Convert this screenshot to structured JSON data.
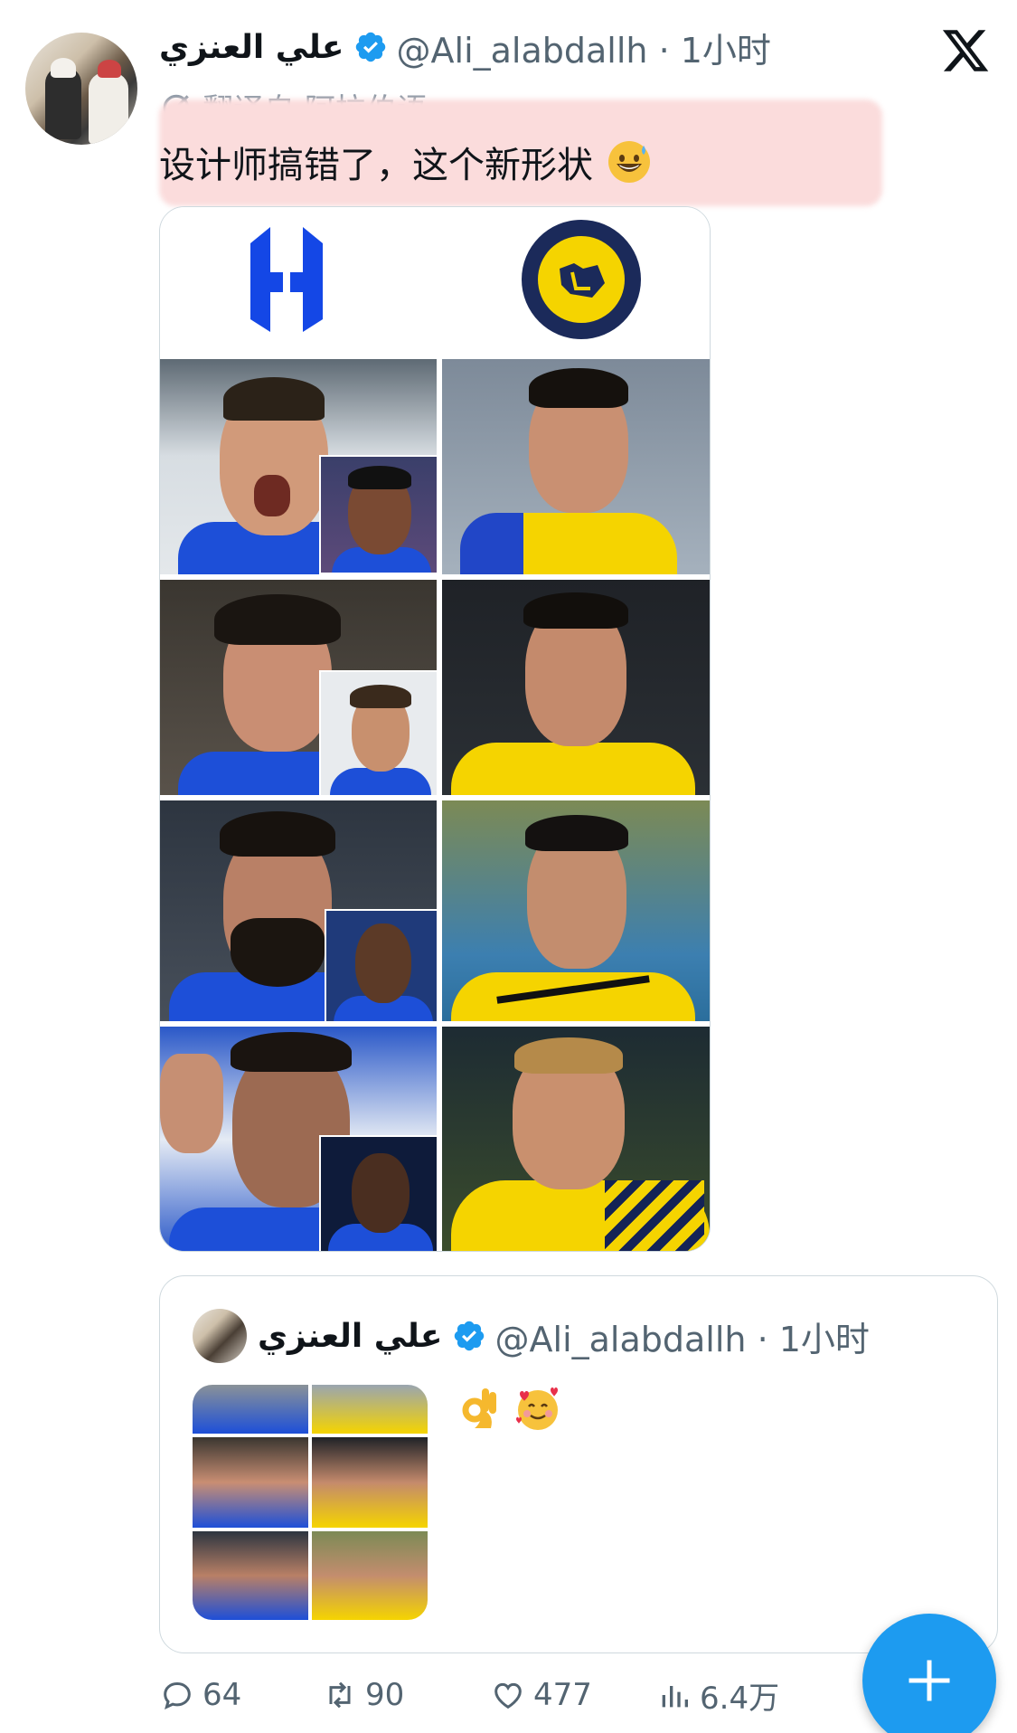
{
  "post": {
    "display_name": "علي العنزي",
    "handle_time": "@Ali_alabdallh · 1小时",
    "translated_label": "翻译自 阿拉伯语",
    "text": "设计师搞错了，这个新形状",
    "text_emoji": "grinning-sweat-emoji"
  },
  "quoted_post": {
    "display_name": "علي العنزي",
    "handle_time": "@Ali_alabdallh · 1小时",
    "emojis": [
      "ok-hand-emoji",
      "smiling-face-with-hearts-emoji"
    ]
  },
  "actions": {
    "replies": "64",
    "reposts": "90",
    "likes": "477",
    "views": "6.4万"
  },
  "colors": {
    "accent": "#1d9bf0",
    "text_secondary": "#536471",
    "hilal_blue": "#1447e6",
    "nassr_yellow": "#f5d400",
    "nassr_navy": "#1b2a5a"
  },
  "icons": {
    "close": "x-logo-icon",
    "verified": "verified-badge-icon",
    "translate": "translate-icon",
    "reply": "reply-icon",
    "repost": "repost-icon",
    "like": "heart-icon",
    "views": "views-icon",
    "compose": "plus-icon"
  }
}
